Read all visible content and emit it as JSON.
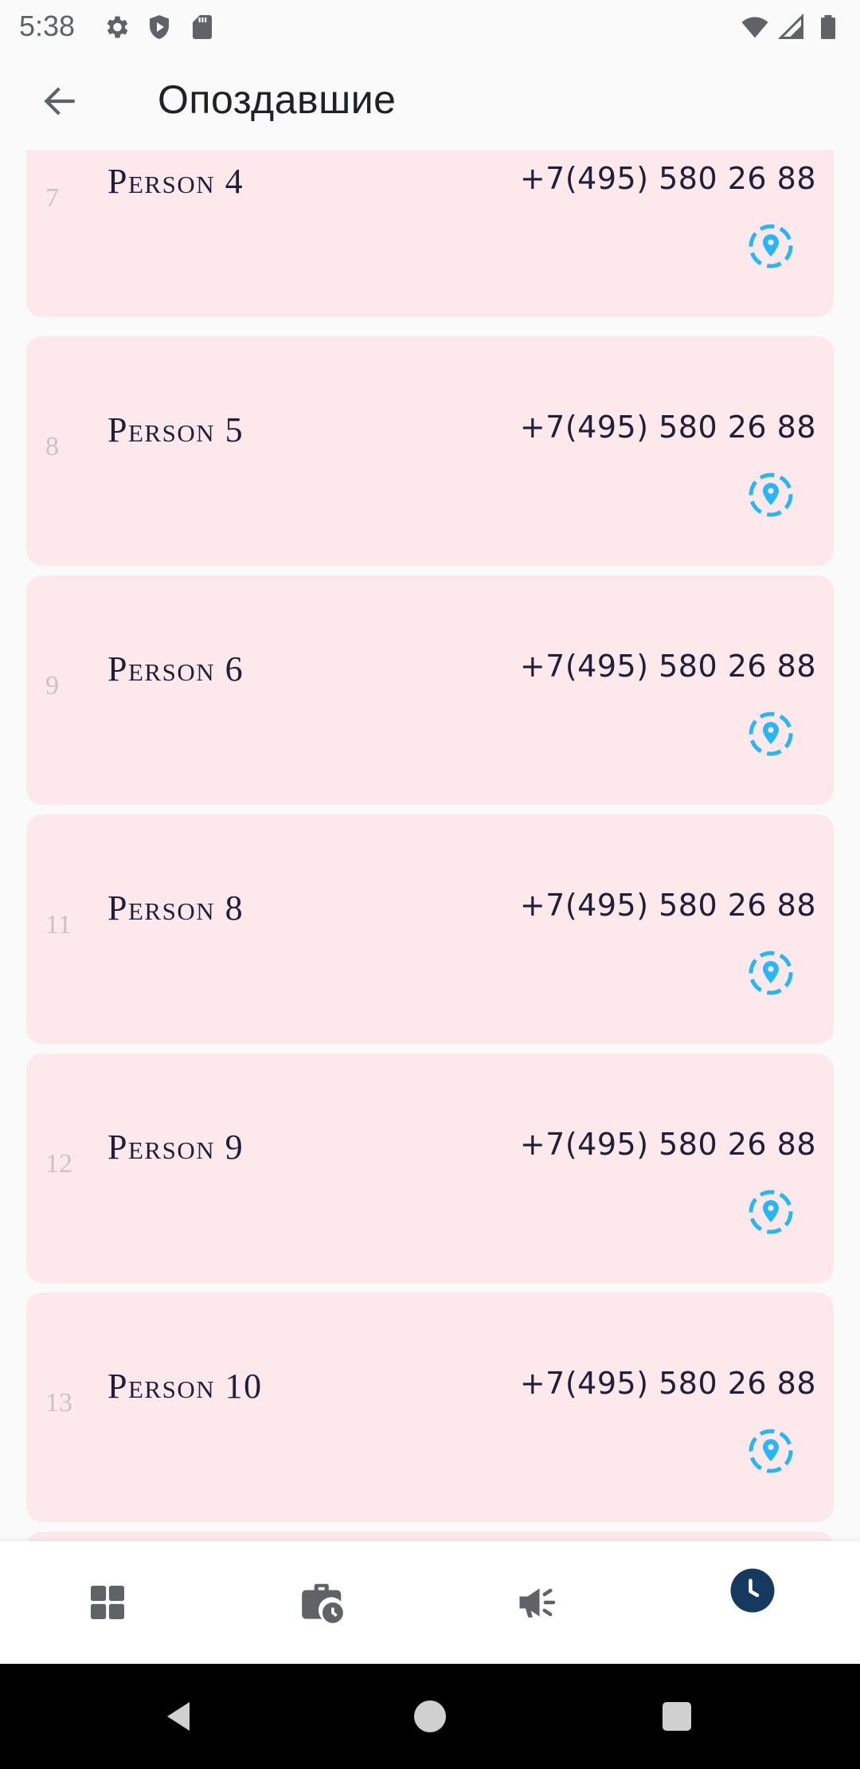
{
  "status_bar": {
    "time": "5:38",
    "left_icons": [
      "settings-icon",
      "shield-play-icon",
      "sd-card-icon"
    ],
    "right_icons": [
      "wifi-icon",
      "signal-icon",
      "battery-icon"
    ]
  },
  "app_bar": {
    "back_icon": "arrow-back-icon",
    "title": "Опоздавшие"
  },
  "list": {
    "items": [
      {
        "number": "7",
        "name": "Person 4",
        "phone": "+7(495) 580 26 88"
      },
      {
        "number": "8",
        "name": "Person 5",
        "phone": "+7(495) 580 26 88"
      },
      {
        "number": "9",
        "name": "Person 6",
        "phone": "+7(495) 580 26 88"
      },
      {
        "number": "11",
        "name": "Person 8",
        "phone": "+7(495) 580 26 88"
      },
      {
        "number": "12",
        "name": "Person 9",
        "phone": "+7(495) 580 26 88"
      },
      {
        "number": "13",
        "name": "Person 10",
        "phone": "+7(495) 580 26 88"
      }
    ],
    "location_icon": "location-pin-icon"
  },
  "bottom_nav": {
    "items": [
      {
        "icon": "dashboard-icon",
        "active": false
      },
      {
        "icon": "work-history-icon",
        "active": false
      },
      {
        "icon": "campaign-icon",
        "active": false
      },
      {
        "icon": "clock-icon",
        "active": true
      }
    ]
  },
  "colors": {
    "card_bg": "#fde8eb",
    "accent": "#29b6f6",
    "active_nav": "#163a5f",
    "inactive_nav": "#5f6368"
  }
}
